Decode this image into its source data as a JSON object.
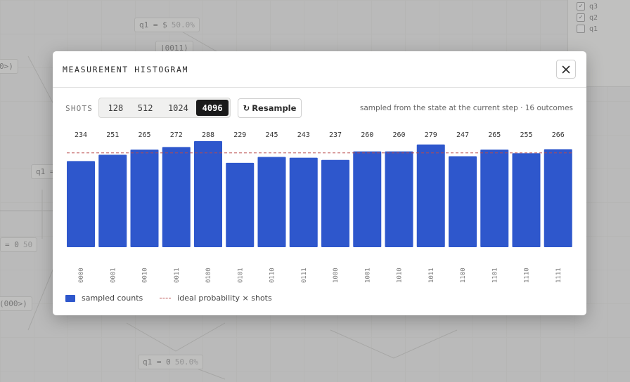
{
  "background": {
    "pill_top": {
      "label": "q1 = $",
      "value": "50.0%"
    },
    "pill_top_sub": "|0011⟩",
    "pill_bottom": {
      "label": "q1 = 0",
      "value": "50.0%"
    },
    "pill_left_mid": "q1 =",
    "pill_left_low": "= 0",
    "pill_left_low_value": "50",
    "ket_left": "0>)",
    "ket_low": "(000>)",
    "panel": {
      "checkboxes": [
        {
          "label": "q3",
          "checked": true
        },
        {
          "label": "q2",
          "checked": true
        },
        {
          "label": "q1",
          "checked": false
        }
      ]
    }
  },
  "modal": {
    "title": "MEASUREMENT HISTOGRAM",
    "close_icon": "close-icon"
  },
  "controls": {
    "shots_label": "SHOTS",
    "shot_options": [
      "128",
      "512",
      "1024",
      "4096"
    ],
    "selected_shots": "4096",
    "resample_label": "Resample",
    "resample_icon": "refresh-icon",
    "status": "sampled from the state at the current step · 16 outcomes"
  },
  "chart_data": {
    "type": "bar",
    "categories": [
      "0000",
      "0001",
      "0010",
      "0011",
      "0100",
      "0101",
      "0110",
      "0111",
      "1000",
      "1001",
      "1010",
      "1011",
      "1100",
      "1101",
      "1110",
      "1111"
    ],
    "series": [
      {
        "name": "sampled counts",
        "values": [
          234,
          251,
          265,
          272,
          288,
          229,
          245,
          243,
          237,
          260,
          260,
          279,
          247,
          265,
          255,
          266
        ],
        "color": "#2e57cc"
      },
      {
        "name": "ideal probability × shots",
        "value": 256,
        "style": "dashed",
        "color": "#b94a4a"
      }
    ],
    "ylim": [
      0,
      288
    ]
  },
  "legend": {
    "sampled": "sampled counts",
    "ideal": "ideal probability × shots"
  }
}
